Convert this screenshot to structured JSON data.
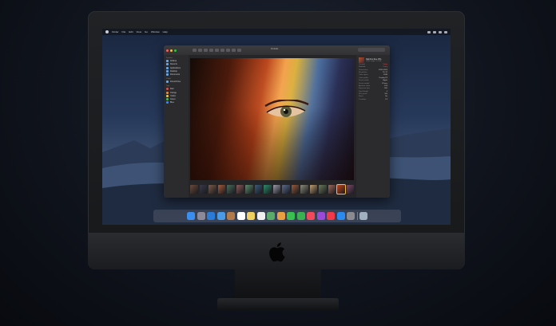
{
  "menubar": {
    "app_name": "Finder",
    "items": [
      "File",
      "Edit",
      "View",
      "Go",
      "Window",
      "Help"
    ]
  },
  "window": {
    "title": "Portraits",
    "sidebar": {
      "favorites_header": "Favorites",
      "favorites": [
        "AirDrop",
        "Recents",
        "Applications",
        "Desktop",
        "Documents"
      ],
      "icloud_header": "iCloud",
      "icloud": [
        "iCloud Drive"
      ],
      "tags_header": "Tags",
      "tags": [
        "Red",
        "Orange",
        "Yellow",
        "Green",
        "Blue"
      ]
    },
    "inspector": {
      "file_name": "Rainbow Eye.JPG",
      "file_size": "JPEG image - 1.6 MB",
      "rows": [
        {
          "k": "Created",
          "v": "Today"
        },
        {
          "k": "Modified",
          "v": "Today"
        },
        {
          "k": "Dimensions",
          "v": "4032×3024"
        },
        {
          "k": "Resolution",
          "v": "72×72"
        },
        {
          "k": "Color space",
          "v": "RGB"
        },
        {
          "k": "Color profile",
          "v": "Display P3"
        },
        {
          "k": "Device make",
          "v": "Apple"
        },
        {
          "k": "Device model",
          "v": "iPhone"
        },
        {
          "k": "Aperture value",
          "v": "1.69"
        },
        {
          "k": "Exposure time",
          "v": "1/60"
        },
        {
          "k": "Focal length",
          "v": "4"
        },
        {
          "k": "ISO speed",
          "v": "100"
        },
        {
          "k": "Flash",
          "v": "No"
        },
        {
          "k": "F number",
          "v": "1.8"
        }
      ]
    }
  },
  "colors": {
    "accent": "#6aa7e8",
    "close": "#ff5f57",
    "minimize": "#febc2e",
    "zoom": "#28c840",
    "selection": "#f0c040"
  },
  "filmstrip": [
    "#6b4a3a",
    "#3a3a4a",
    "#7a5a4a",
    "#a85a3a",
    "#4a6a5a",
    "#8a5a5a",
    "#5a8a6a",
    "#3a5a7a",
    "#2a8a6a",
    "#9a9aaa",
    "#5a6a8a",
    "#9a5a3a",
    "#8a8a7a",
    "#c0a070",
    "#6a7a5a",
    "#a06a5a",
    "#c2441c",
    "#7a4a6a"
  ],
  "dock": [
    "finder-icon",
    "launchpad-icon",
    "safari-icon",
    "mail-icon",
    "contacts-icon",
    "calendar-icon",
    "notes-icon",
    "reminders-icon",
    "maps-icon",
    "photos-icon",
    "messages-icon",
    "facetime-icon",
    "music-icon",
    "podcasts-icon",
    "news-icon",
    "app-store-icon",
    "system-preferences-icon",
    "trash-icon"
  ],
  "dock_colors": [
    "#3a8ef0",
    "#8a8a9a",
    "#2a7ad8",
    "#4a9ae8",
    "#b07a4a",
    "#ffffff",
    "#f0d060",
    "#f0f0f0",
    "#5aaa6a",
    "#e8a040",
    "#3ac050",
    "#3ab050",
    "#f04a5a",
    "#9a4ad8",
    "#f03a4a",
    "#2a8af0",
    "#8a8a90",
    "#a0b0c0"
  ]
}
